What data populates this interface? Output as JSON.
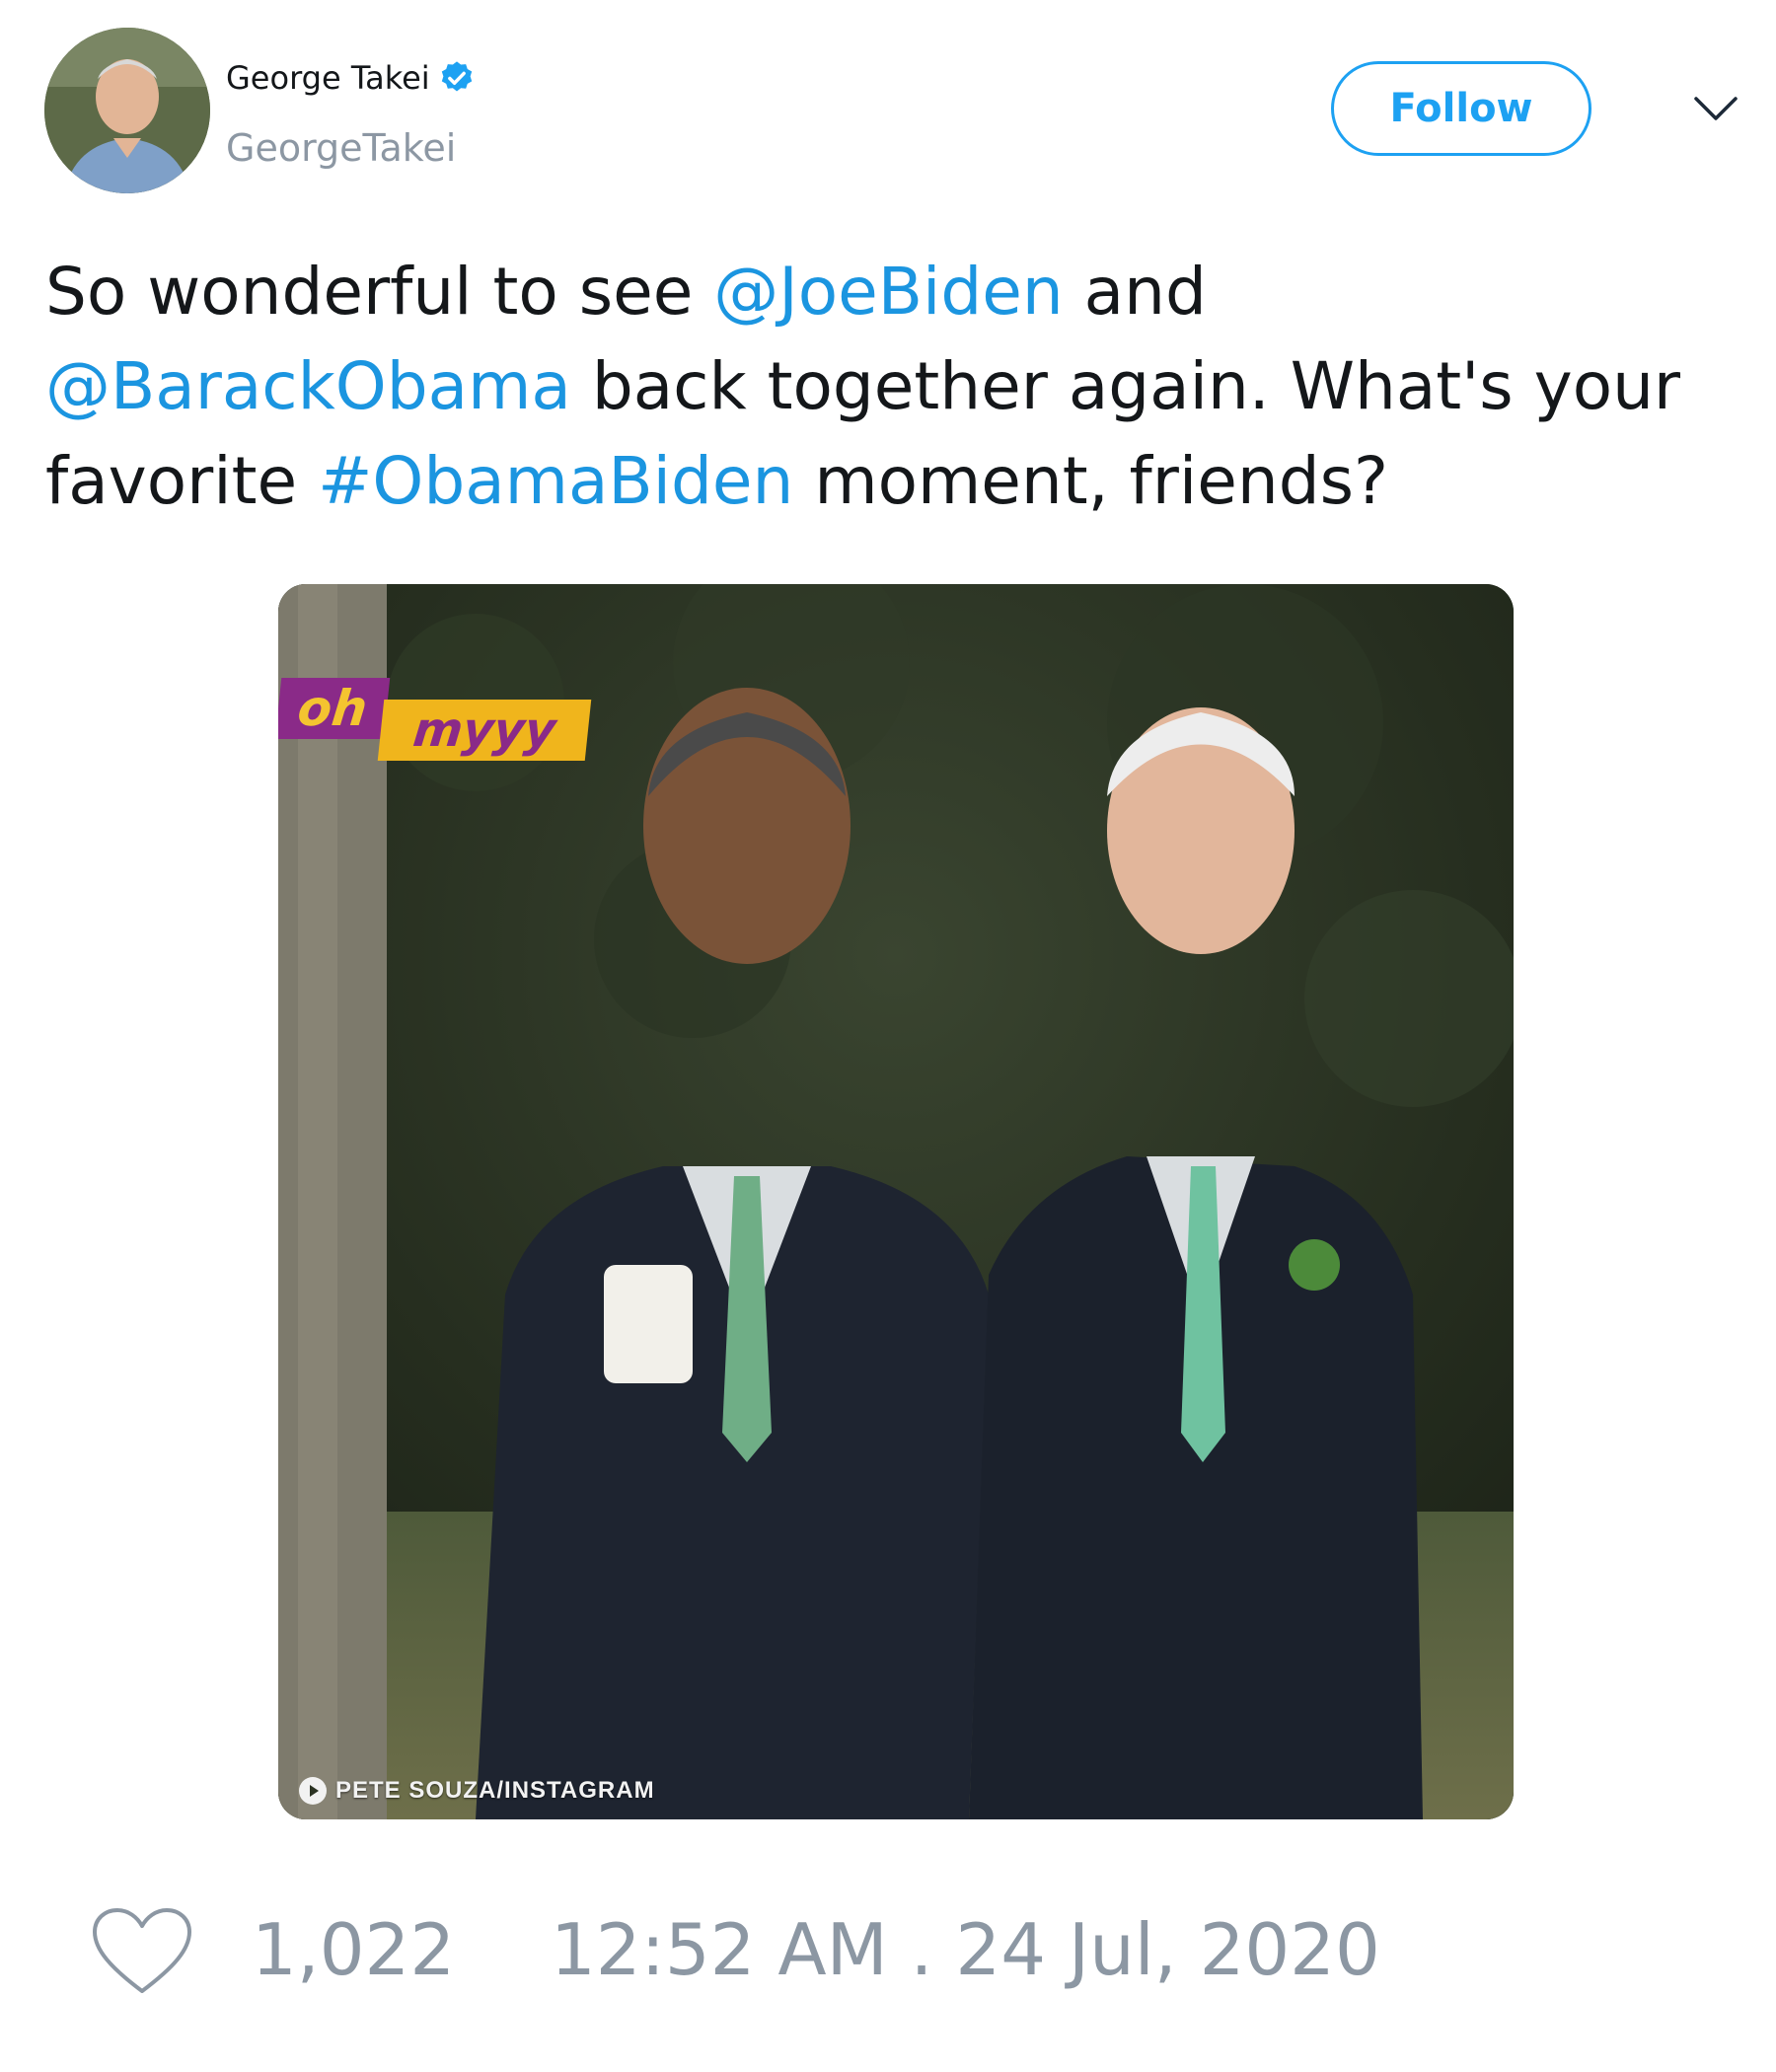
{
  "tweet": {
    "author": {
      "display_name": "George Takei",
      "handle": "GeorgeTakei",
      "verified": true,
      "avatar_icon": "profile-photo"
    },
    "follow_label": "Follow",
    "menu_icon": "chevron-down-icon",
    "text": {
      "part1": "So wonderful to see ",
      "mention1": "@JoeBiden",
      "part2": " and ",
      "mention2": "@BarackObama",
      "part3": " back together again. What's your favorite ",
      "hashtag": "#ObamaBiden",
      "part4": " moment, friends?"
    },
    "media": {
      "logo_oh": "oh",
      "logo_myyy": "myyy",
      "credit": "PETE SOUZA/INSTAGRAM"
    },
    "like_count": "1,022",
    "timestamp": "12:52 AM . 24 Jul, 2020",
    "colors": {
      "link": "#1b95e0",
      "follow": "#1da1f2",
      "muted": "#8c97a3"
    }
  }
}
